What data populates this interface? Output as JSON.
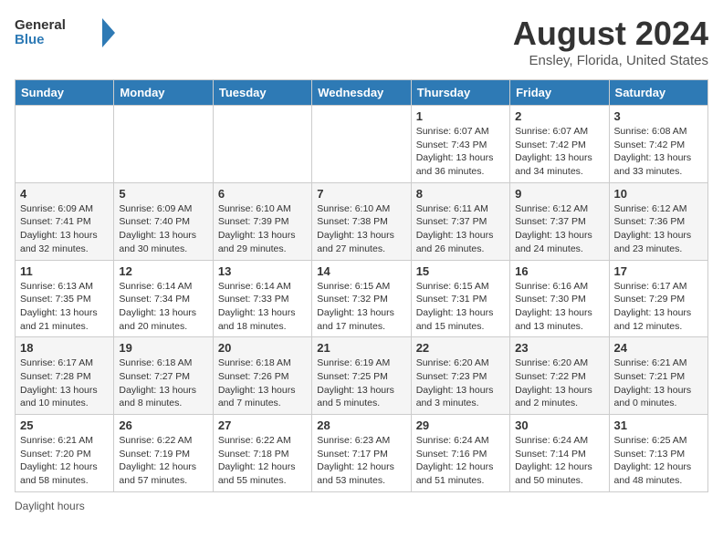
{
  "header": {
    "logo_general": "General",
    "logo_blue": "Blue",
    "month_title": "August 2024",
    "location": "Ensley, Florida, United States"
  },
  "calendar": {
    "days_of_week": [
      "Sunday",
      "Monday",
      "Tuesday",
      "Wednesday",
      "Thursday",
      "Friday",
      "Saturday"
    ],
    "weeks": [
      [
        {
          "day": "",
          "info": ""
        },
        {
          "day": "",
          "info": ""
        },
        {
          "day": "",
          "info": ""
        },
        {
          "day": "",
          "info": ""
        },
        {
          "day": "1",
          "info": "Sunrise: 6:07 AM\nSunset: 7:43 PM\nDaylight: 13 hours and 36 minutes."
        },
        {
          "day": "2",
          "info": "Sunrise: 6:07 AM\nSunset: 7:42 PM\nDaylight: 13 hours and 34 minutes."
        },
        {
          "day": "3",
          "info": "Sunrise: 6:08 AM\nSunset: 7:42 PM\nDaylight: 13 hours and 33 minutes."
        }
      ],
      [
        {
          "day": "4",
          "info": "Sunrise: 6:09 AM\nSunset: 7:41 PM\nDaylight: 13 hours and 32 minutes."
        },
        {
          "day": "5",
          "info": "Sunrise: 6:09 AM\nSunset: 7:40 PM\nDaylight: 13 hours and 30 minutes."
        },
        {
          "day": "6",
          "info": "Sunrise: 6:10 AM\nSunset: 7:39 PM\nDaylight: 13 hours and 29 minutes."
        },
        {
          "day": "7",
          "info": "Sunrise: 6:10 AM\nSunset: 7:38 PM\nDaylight: 13 hours and 27 minutes."
        },
        {
          "day": "8",
          "info": "Sunrise: 6:11 AM\nSunset: 7:37 PM\nDaylight: 13 hours and 26 minutes."
        },
        {
          "day": "9",
          "info": "Sunrise: 6:12 AM\nSunset: 7:37 PM\nDaylight: 13 hours and 24 minutes."
        },
        {
          "day": "10",
          "info": "Sunrise: 6:12 AM\nSunset: 7:36 PM\nDaylight: 13 hours and 23 minutes."
        }
      ],
      [
        {
          "day": "11",
          "info": "Sunrise: 6:13 AM\nSunset: 7:35 PM\nDaylight: 13 hours and 21 minutes."
        },
        {
          "day": "12",
          "info": "Sunrise: 6:14 AM\nSunset: 7:34 PM\nDaylight: 13 hours and 20 minutes."
        },
        {
          "day": "13",
          "info": "Sunrise: 6:14 AM\nSunset: 7:33 PM\nDaylight: 13 hours and 18 minutes."
        },
        {
          "day": "14",
          "info": "Sunrise: 6:15 AM\nSunset: 7:32 PM\nDaylight: 13 hours and 17 minutes."
        },
        {
          "day": "15",
          "info": "Sunrise: 6:15 AM\nSunset: 7:31 PM\nDaylight: 13 hours and 15 minutes."
        },
        {
          "day": "16",
          "info": "Sunrise: 6:16 AM\nSunset: 7:30 PM\nDaylight: 13 hours and 13 minutes."
        },
        {
          "day": "17",
          "info": "Sunrise: 6:17 AM\nSunset: 7:29 PM\nDaylight: 13 hours and 12 minutes."
        }
      ],
      [
        {
          "day": "18",
          "info": "Sunrise: 6:17 AM\nSunset: 7:28 PM\nDaylight: 13 hours and 10 minutes."
        },
        {
          "day": "19",
          "info": "Sunrise: 6:18 AM\nSunset: 7:27 PM\nDaylight: 13 hours and 8 minutes."
        },
        {
          "day": "20",
          "info": "Sunrise: 6:18 AM\nSunset: 7:26 PM\nDaylight: 13 hours and 7 minutes."
        },
        {
          "day": "21",
          "info": "Sunrise: 6:19 AM\nSunset: 7:25 PM\nDaylight: 13 hours and 5 minutes."
        },
        {
          "day": "22",
          "info": "Sunrise: 6:20 AM\nSunset: 7:23 PM\nDaylight: 13 hours and 3 minutes."
        },
        {
          "day": "23",
          "info": "Sunrise: 6:20 AM\nSunset: 7:22 PM\nDaylight: 13 hours and 2 minutes."
        },
        {
          "day": "24",
          "info": "Sunrise: 6:21 AM\nSunset: 7:21 PM\nDaylight: 13 hours and 0 minutes."
        }
      ],
      [
        {
          "day": "25",
          "info": "Sunrise: 6:21 AM\nSunset: 7:20 PM\nDaylight: 12 hours and 58 minutes."
        },
        {
          "day": "26",
          "info": "Sunrise: 6:22 AM\nSunset: 7:19 PM\nDaylight: 12 hours and 57 minutes."
        },
        {
          "day": "27",
          "info": "Sunrise: 6:22 AM\nSunset: 7:18 PM\nDaylight: 12 hours and 55 minutes."
        },
        {
          "day": "28",
          "info": "Sunrise: 6:23 AM\nSunset: 7:17 PM\nDaylight: 12 hours and 53 minutes."
        },
        {
          "day": "29",
          "info": "Sunrise: 6:24 AM\nSunset: 7:16 PM\nDaylight: 12 hours and 51 minutes."
        },
        {
          "day": "30",
          "info": "Sunrise: 6:24 AM\nSunset: 7:14 PM\nDaylight: 12 hours and 50 minutes."
        },
        {
          "day": "31",
          "info": "Sunrise: 6:25 AM\nSunset: 7:13 PM\nDaylight: 12 hours and 48 minutes."
        }
      ]
    ]
  },
  "footer": {
    "daylight_label": "Daylight hours"
  }
}
